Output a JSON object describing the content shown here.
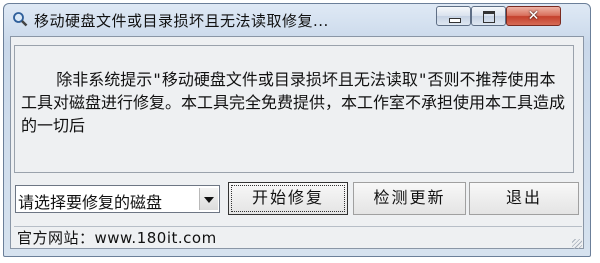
{
  "window": {
    "title": "移动硬盘文件或目录损坏且无法读取修复...",
    "icon": "magnifier-icon",
    "controls": {
      "close": "✕"
    }
  },
  "message": {
    "text": "除非系统提示\"移动硬盘文件或目录损坏且无法读取\"否则不推荐使用本工具对磁盘进行修复。本工具完全免费提供，本工作室不承担使用本工具造成的一切后"
  },
  "disk_select": {
    "value": "请选择要修复的磁盘"
  },
  "buttons": {
    "start": "开始修复",
    "check_update": "检测更新",
    "exit": "退出"
  },
  "status": {
    "text": "官方网站：www.180it.com"
  },
  "colors": {
    "accent": "#c4402c",
    "titlebar": "#c9d8ea"
  }
}
